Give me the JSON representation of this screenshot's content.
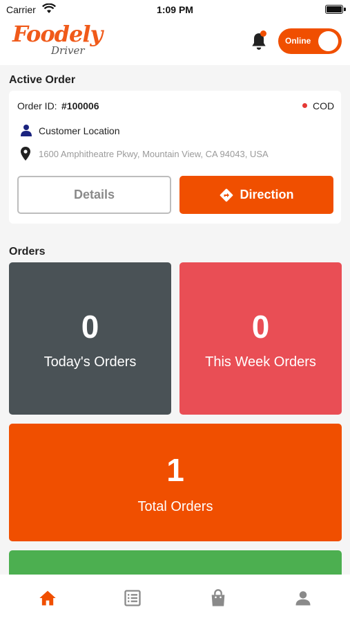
{
  "status_bar": {
    "carrier": "Carrier",
    "time": "1:09 PM"
  },
  "header": {
    "logo_main": "Foodely",
    "logo_sub": "Driver",
    "toggle_label": "Online",
    "online": true
  },
  "active_order": {
    "section_title": "Active Order",
    "order_id_label": "Order ID:",
    "order_id": "#100006",
    "payment": "COD",
    "customer_label": "Customer Location",
    "address": "1600 Amphitheatre Pkwy, Mountain View, CA 94043, USA",
    "details_label": "Details",
    "direction_label": "Direction"
  },
  "orders": {
    "section_title": "Orders",
    "today": {
      "value": "0",
      "label": "Today's Orders"
    },
    "week": {
      "value": "0",
      "label": "This Week Orders"
    },
    "total": {
      "value": "1",
      "label": "Total Orders"
    }
  },
  "colors": {
    "accent": "#f04f00",
    "today_card": "#4a5256",
    "week_card": "#e94e55",
    "total_card": "#f04f00",
    "green_card": "#4caf50"
  },
  "tabs": [
    {
      "icon": "home-icon",
      "active": true
    },
    {
      "icon": "list-icon",
      "active": false
    },
    {
      "icon": "shopping-bag-icon",
      "active": false
    },
    {
      "icon": "profile-icon",
      "active": false
    }
  ]
}
